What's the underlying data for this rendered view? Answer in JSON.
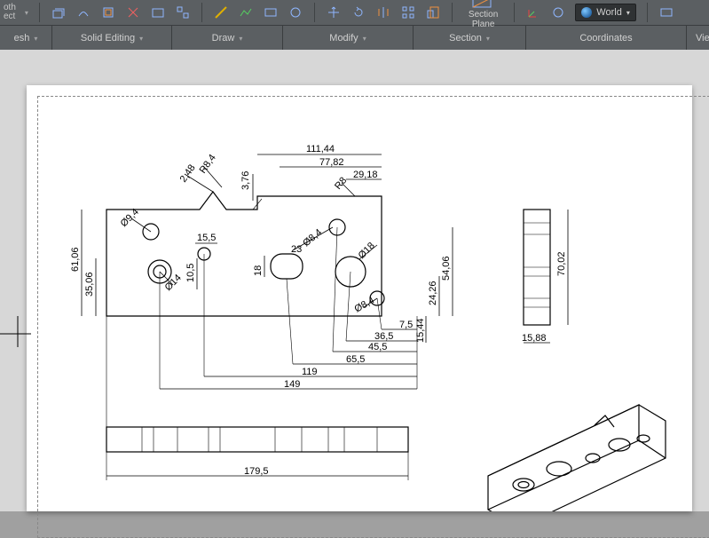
{
  "ribbon": {
    "big_section_plane": "Section\nPlane",
    "coord_selector": "World",
    "panels": {
      "mesh": "esh",
      "solid_editing": "Solid Editing",
      "draw": "Draw",
      "modify": "Modify",
      "section": "Section",
      "coordinates": "Coordinates",
      "view": "View"
    }
  },
  "drawing": {
    "dims": {
      "d111_44": "111,44",
      "d77_82": "77,82",
      "d29_18": "29,18",
      "d2_48": "2,48",
      "r8_4": "R8,4",
      "d3_76": "3,76",
      "r8": "R8",
      "d61_06": "61,06",
      "d35_06": "35,06",
      "phi9_4": "Ø9,4",
      "d15_5": "15,5",
      "d23": "23",
      "phi8_4_a": "Ø8,4",
      "phi18": "Ø18",
      "phi14": "Ø14",
      "d10_5": "10,5",
      "d18": "18",
      "phi8_4_b": "Ø8,4",
      "d7_5": "7,5",
      "d36_5": "36,5",
      "d45_5": "45,5",
      "d65_5": "65,5",
      "d119": "119",
      "d149": "149",
      "d179_5": "179,5",
      "d24_26": "24,26",
      "d54_06": "54,06",
      "d15_44": "15,44",
      "d70_02": "70,02",
      "d15_88": "15,88"
    }
  }
}
